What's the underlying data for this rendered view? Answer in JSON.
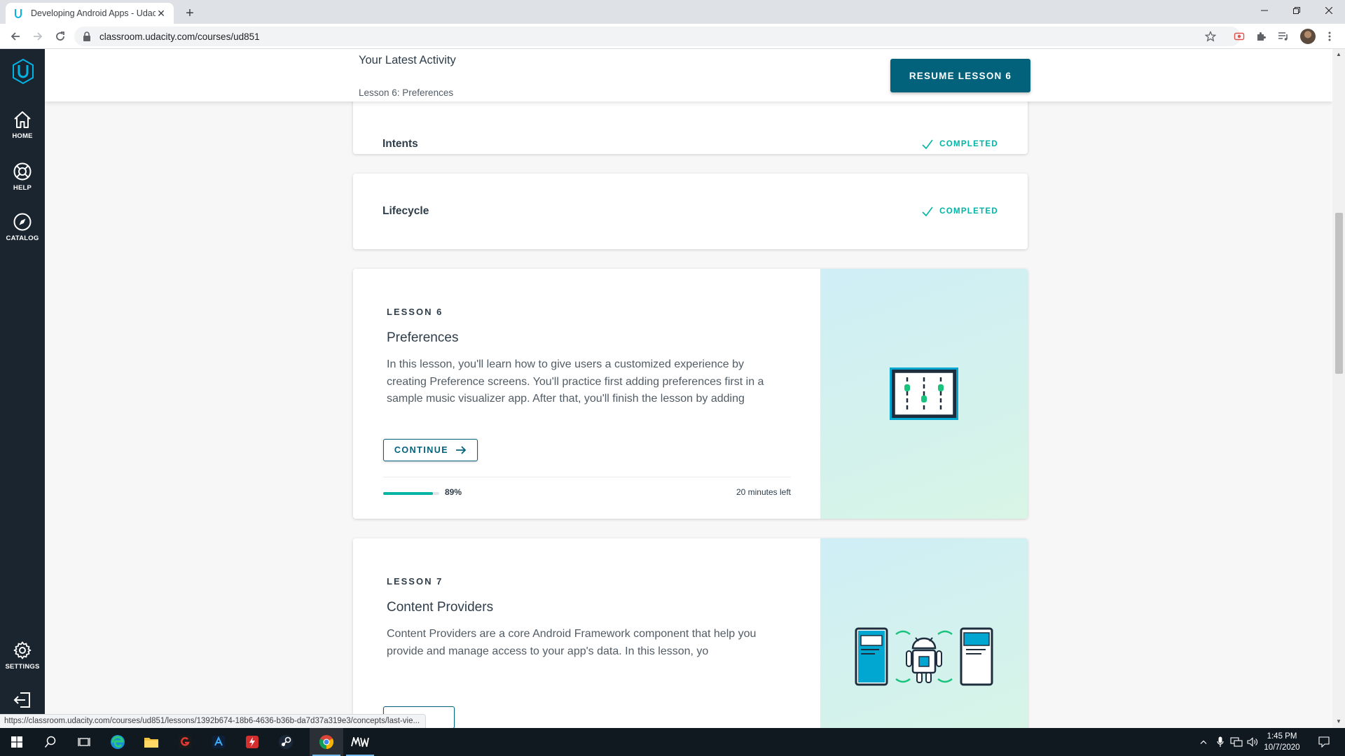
{
  "browser": {
    "tab_title": "Developing Android Apps - Udac",
    "url": "classroom.udacity.com/courses/ud851",
    "status_url": "https://classroom.udacity.com/courses/ud851/lessons/1392b674-18b6-4636-b36b-da7d37a319e3/concepts/last-vie..."
  },
  "sidebar": {
    "items": [
      {
        "label": "HOME",
        "icon": "home-icon"
      },
      {
        "label": "HELP",
        "icon": "lifebuoy-icon"
      },
      {
        "label": "CATALOG",
        "icon": "compass-icon"
      },
      {
        "label": "SETTINGS",
        "icon": "gear-icon"
      }
    ]
  },
  "activity": {
    "title": "Your Latest Activity",
    "subtitle": "Lesson 6: Preferences",
    "resume_label": "RESUME LESSON 6"
  },
  "concepts": [
    {
      "title": "Intents",
      "status": "COMPLETED"
    },
    {
      "title": "Lifecycle",
      "status": "COMPLETED"
    }
  ],
  "lessons": [
    {
      "number": "LESSON 6",
      "name": "Preferences",
      "description": "In this lesson, you'll learn how to give users a customized experience by creating Preference screens. You'll practice first adding preferences first in a sample music visualizer app. After that, you'll finish the lesson by adding",
      "button": "CONTINUE",
      "progress": 0.89,
      "progress_label": "89%",
      "time_left": "20 minutes left",
      "illustration": "sliders-icon"
    },
    {
      "number": "LESSON 7",
      "name": "Content Providers",
      "description": "Content Providers are a core Android Framework component that help you provide and manage access to your app's data. In this lesson, yo",
      "illustration": "android-data-sync-icon"
    }
  ],
  "taskbar": {
    "time": "1:45 PM",
    "date": "10/7/2020"
  },
  "colors": {
    "sidebar": "#1a2530",
    "primary": "#02627c",
    "accent": "#02b3a4"
  }
}
